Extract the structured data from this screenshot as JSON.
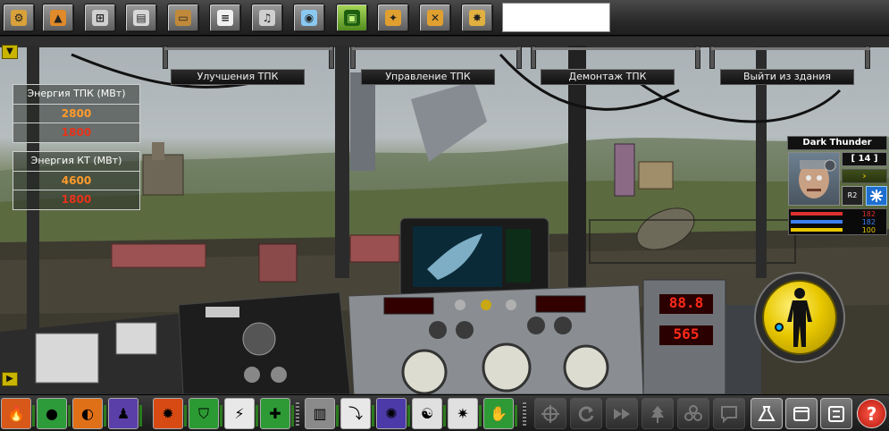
{
  "top_toolbar": {
    "buttons": [
      {
        "icon": "gears-icon"
      },
      {
        "icon": "stamp-icon"
      },
      {
        "icon": "network-icon"
      },
      {
        "icon": "news-icon"
      },
      {
        "icon": "briefcase-icon"
      },
      {
        "icon": "document-icon"
      },
      {
        "icon": "music-icon"
      },
      {
        "icon": "globe-icon"
      },
      {
        "icon": "floppy-disk-icon",
        "active": true
      },
      {
        "icon": "fight-icon"
      },
      {
        "icon": "crossed-weapons-icon"
      },
      {
        "icon": "explosion-icon"
      }
    ],
    "chat_input_value": ""
  },
  "building_actions": [
    {
      "label": "Улучшения ТПК"
    },
    {
      "label": "Управление ТПК"
    },
    {
      "label": "Демонтаж ТПК"
    },
    {
      "label": "Выйти из здания"
    }
  ],
  "energy_tpk": {
    "title": "Энергия ТПК (МВт)",
    "value_primary": "2800",
    "value_secondary": "1800"
  },
  "energy_kt": {
    "title": "Энергия КТ (МВт)",
    "value_primary": "4600",
    "value_secondary": "1800"
  },
  "player": {
    "name": "Dark Thunder",
    "level": "14",
    "badge": "R2",
    "stat_red": "182",
    "stat_blue": "182",
    "stat_yellow": "100",
    "hp_fraction": 1.0,
    "mana_fraction": 1.0,
    "stamina_fraction": 1.0
  },
  "control_panel": {
    "display_1": "88.8",
    "display_2": "565"
  },
  "skills": [
    {
      "icon": "fire-icon",
      "color": "#d8581a"
    },
    {
      "icon": "green-blob-icon",
      "color": "#2d9b3a"
    },
    {
      "icon": "flame-ring-icon",
      "color": "#e07018"
    },
    {
      "icon": "figure-icon",
      "color": "#5b3fa8"
    },
    {
      "icon": "burst-icon",
      "color": "#d84a14"
    },
    {
      "icon": "shield-icon",
      "color": "#2c9a33"
    },
    {
      "icon": "lightning-figure-icon",
      "color": "#e8e8e8"
    },
    {
      "icon": "heal-plus-icon",
      "color": "#2e9a36"
    },
    {
      "icon": "canister-icon",
      "color": "#8a8a8a"
    },
    {
      "icon": "dive-icon",
      "color": "#e8e8e8"
    },
    {
      "icon": "aura-icon",
      "color": "#4b3aa8"
    },
    {
      "icon": "meditate-icon",
      "color": "#e0e0e0"
    },
    {
      "icon": "shout-icon",
      "color": "#e0e0e0"
    },
    {
      "icon": "heal-hand-icon",
      "color": "#2e9a36"
    }
  ],
  "actions": [
    {
      "icon": "target-icon",
      "enabled": false
    },
    {
      "icon": "refresh-icon",
      "enabled": false
    },
    {
      "icon": "fast-forward-icon",
      "enabled": false
    },
    {
      "icon": "tree-icon",
      "enabled": false
    },
    {
      "icon": "group-icon",
      "enabled": false
    },
    {
      "icon": "chat-bubble-icon",
      "enabled": false
    },
    {
      "icon": "bag-icon",
      "enabled": true
    },
    {
      "icon": "window-icon",
      "enabled": true
    },
    {
      "icon": "settings-list-icon",
      "enabled": true
    },
    {
      "icon": "help-icon",
      "enabled": true
    }
  ],
  "colors": {
    "energy_primary": "#ff9a2a",
    "energy_secondary": "#e8331a",
    "stat_red": "#e03030",
    "stat_blue": "#3a7ff0",
    "stat_yellow": "#e8c800",
    "led_red": "#ff2a1a"
  }
}
